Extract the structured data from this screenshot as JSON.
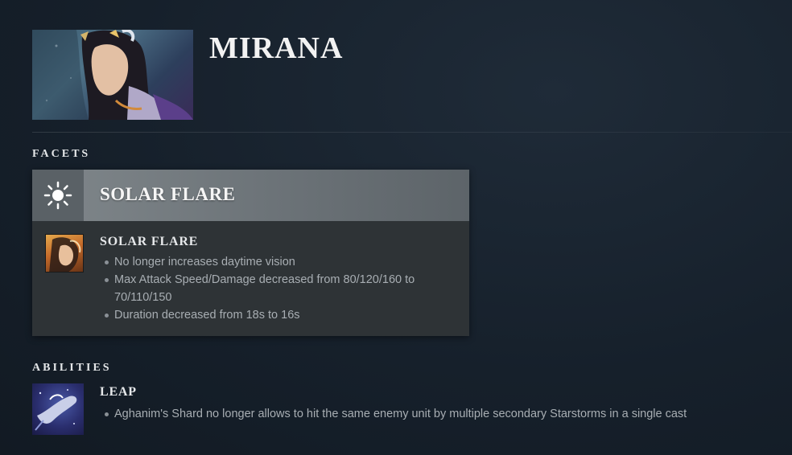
{
  "hero": {
    "name": "MIRANA"
  },
  "sections": {
    "facets_label": "FACETS",
    "abilities_label": "ABILITIES"
  },
  "facet": {
    "title": "SOLAR FLARE",
    "icon": "sun-icon",
    "ability_name": "SOLAR FLARE",
    "notes": [
      "No longer increases daytime vision",
      "Max Attack Speed/Damage decreased from 80/120/160 to 70/110/150",
      "Duration decreased from 18s to 16s"
    ]
  },
  "ability": {
    "name": "LEAP",
    "notes": [
      "Aghanim's Shard no longer allows to hit the same enemy unit by multiple secondary Starstorms in a single cast"
    ]
  },
  "colors": {
    "background": "#16202b",
    "facet_header": "#80878b",
    "facet_body": "#2e3336"
  }
}
